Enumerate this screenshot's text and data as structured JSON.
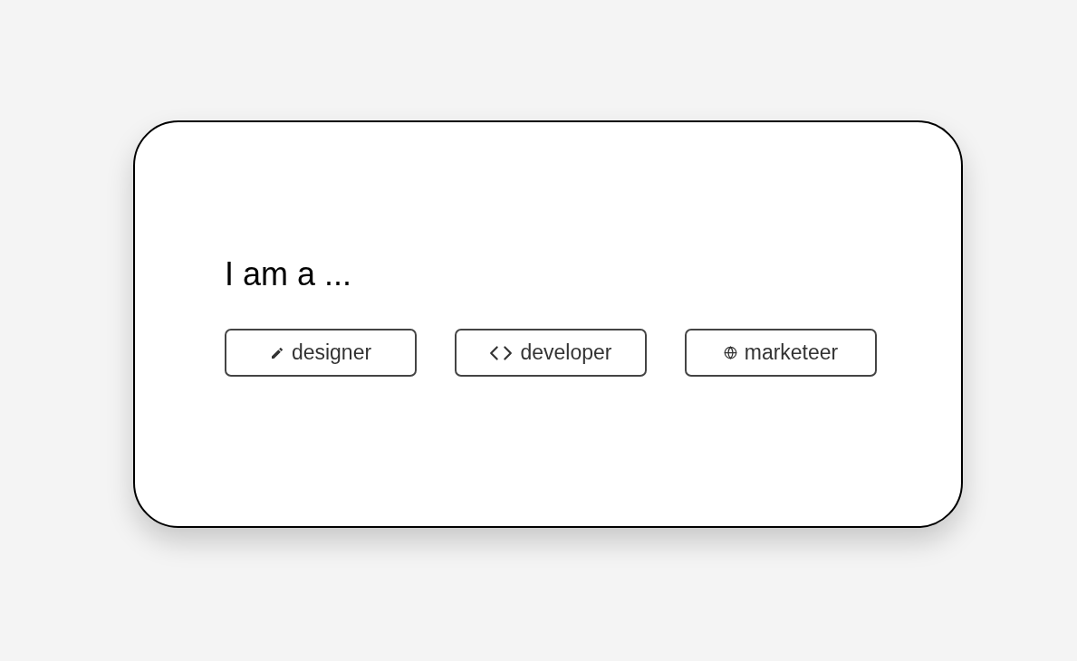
{
  "heading": "I am a ...",
  "roles": [
    {
      "label": "designer",
      "kind": "pencil"
    },
    {
      "label": "developer",
      "kind": "code"
    },
    {
      "label": "marketeer",
      "kind": "globe"
    }
  ]
}
